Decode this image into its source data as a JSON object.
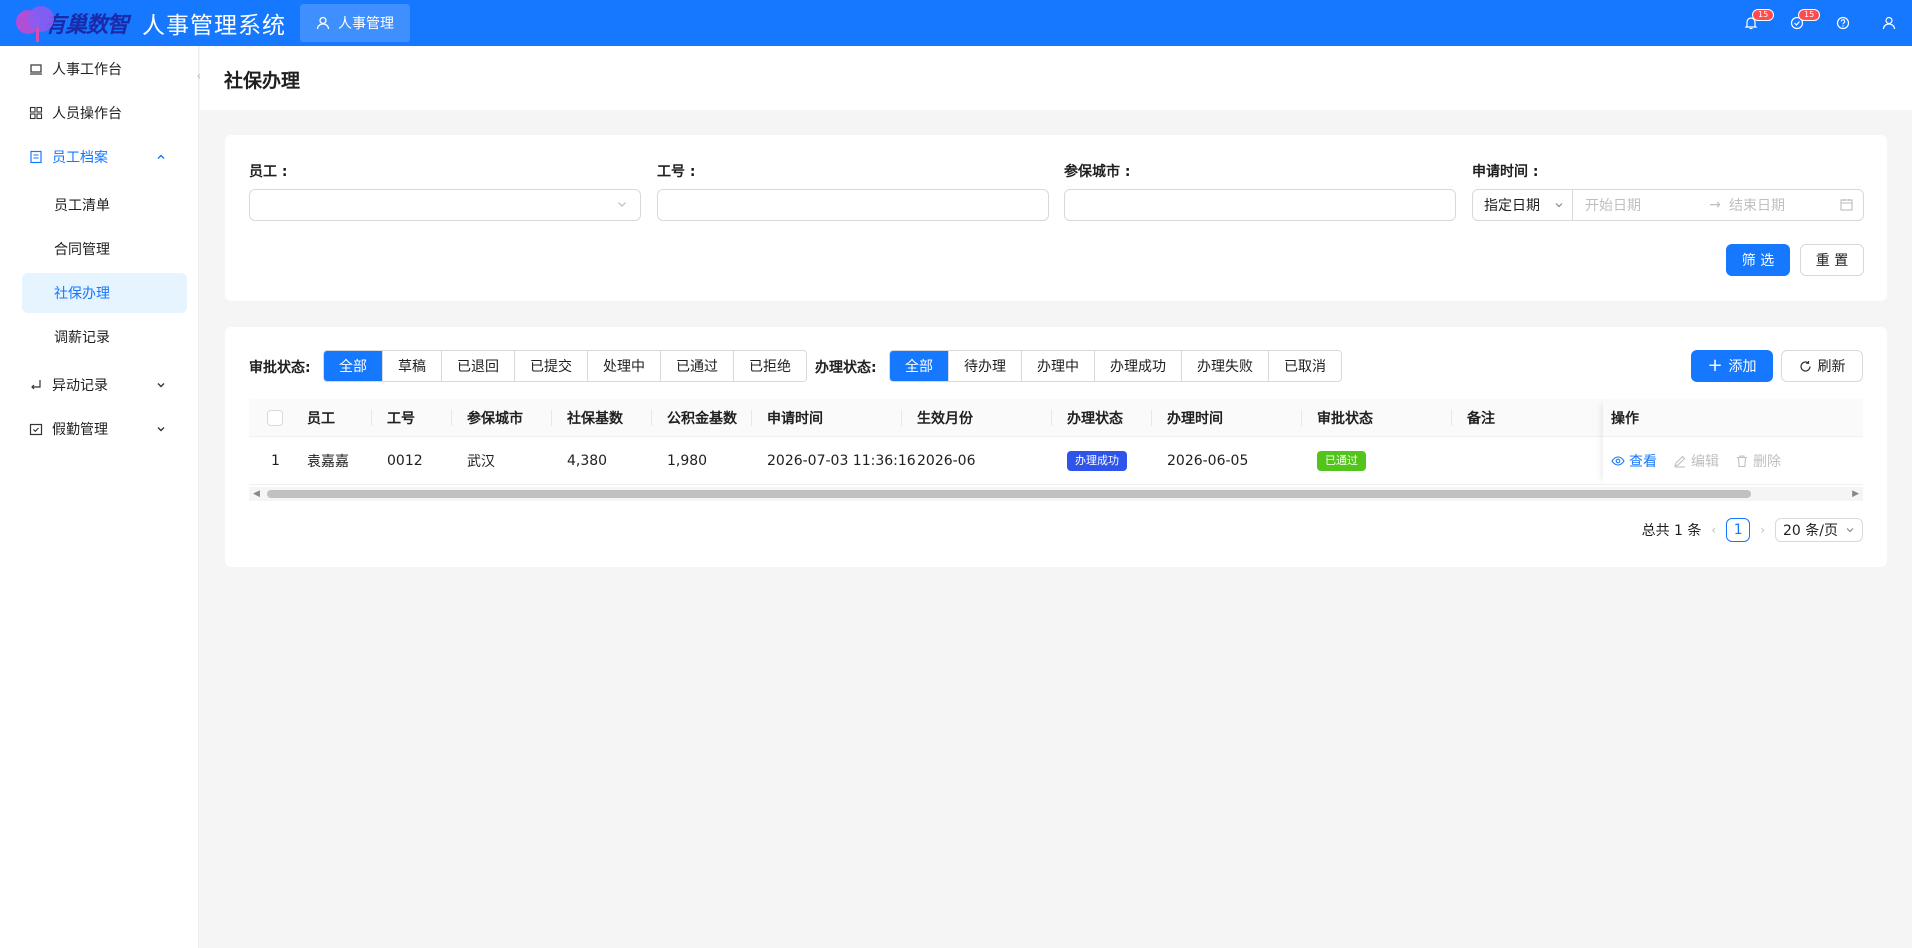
{
  "header": {
    "logo_text": "有巢数智",
    "app_title": "人事管理系统",
    "module_tab": "人事管理",
    "notification_badge": "15",
    "task_badge": "15"
  },
  "sidebar": {
    "items": [
      {
        "label": "人事工作台"
      },
      {
        "label": "人员操作台"
      },
      {
        "label": "员工档案"
      },
      {
        "label": "员工清单"
      },
      {
        "label": "合同管理"
      },
      {
        "label": "社保办理"
      },
      {
        "label": "调薪记录"
      },
      {
        "label": "异动记录"
      },
      {
        "label": "假勤管理"
      }
    ]
  },
  "page": {
    "title": "社保办理"
  },
  "filters": {
    "employee_label": "员工 :",
    "employee_no_label": "工号 :",
    "city_label": "参保城市 :",
    "apply_time_label": "申请时间 :",
    "date_type": "指定日期",
    "start_placeholder": "开始日期",
    "end_placeholder": "结束日期",
    "filter_button": "筛 选",
    "reset_button": "重 置"
  },
  "approval_status": {
    "label": "审批状态:",
    "options": [
      "全部",
      "草稿",
      "已退回",
      "已提交",
      "处理中",
      "已通过",
      "已拒绝"
    ]
  },
  "process_status": {
    "label": "办理状态:",
    "options": [
      "全部",
      "待办理",
      "办理中",
      "办理成功",
      "办理失败",
      "已取消"
    ]
  },
  "toolbar": {
    "add_button": "添加",
    "refresh_button": "刷新"
  },
  "table": {
    "columns": [
      "员工",
      "工号",
      "参保城市",
      "社保基数",
      "公积金基数",
      "申请时间",
      "生效月份",
      "办理状态",
      "办理时间",
      "审批状态",
      "备注",
      "操作"
    ],
    "rows": [
      {
        "index": "1",
        "employee": "袁嘉嘉",
        "employee_no": "0012",
        "city": "武汉",
        "social_base": "4,380",
        "fund_base": "1,980",
        "apply_time": "2026-07-03 11:36:16",
        "effective_month": "2026-06",
        "process_status": "办理成功",
        "process_time": "2026-06-05",
        "approval_status": "已通过",
        "remark": "",
        "actions": {
          "view": "查看",
          "edit": "编辑",
          "delete": "删除"
        }
      }
    ]
  },
  "pagination": {
    "total": "总共 1 条",
    "current": "1",
    "page_size": "20 条/页"
  },
  "colors": {
    "primary": "#1677ff",
    "success_tag": "#52c41a",
    "process_tag": "#2f54eb"
  }
}
